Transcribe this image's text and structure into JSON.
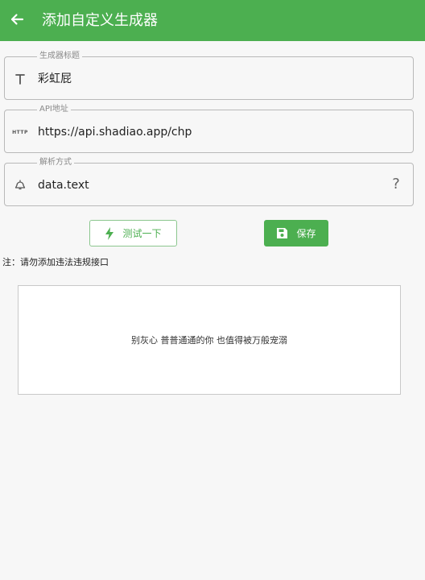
{
  "appbar": {
    "title": "添加自定义生成器"
  },
  "fields": {
    "title_field": {
      "label": "生成器标题",
      "value": "彩虹屁",
      "icon": "text-format-icon"
    },
    "api_field": {
      "label": "API地址",
      "value": "https://api.shadiao.app/chp",
      "icon": "http-icon",
      "icon_text": "HTTP"
    },
    "parse_field": {
      "label": "解析方式",
      "value": "data.text",
      "icon": "filter-icon",
      "help": "?"
    }
  },
  "buttons": {
    "test_label": "测试一下",
    "save_label": "保存"
  },
  "note": "注：请勿添加违法违规接口",
  "result": {
    "text": "别灰心  普普通通的你 也值得被万般宠溺"
  },
  "colors": {
    "accent": "#4caf50",
    "background": "#f7f7f7"
  }
}
